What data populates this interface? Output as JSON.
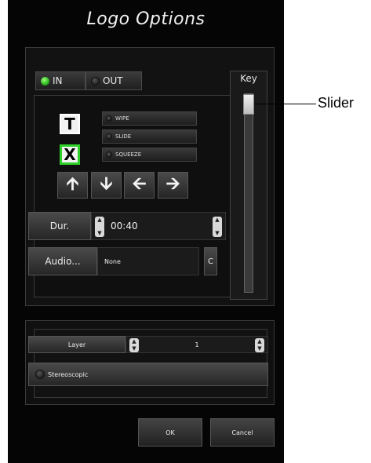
{
  "dialog": {
    "title": "Logo Options"
  },
  "tabs": [
    {
      "label": "IN",
      "active": true
    },
    {
      "label": "OUT",
      "active": false
    }
  ],
  "type_buttons": [
    {
      "label": "T"
    },
    {
      "label": "X"
    }
  ],
  "transitions": [
    {
      "label": "WIPE"
    },
    {
      "label": "SLIDE"
    },
    {
      "label": "SQUEEZE"
    }
  ],
  "arrows": [
    "up-arrow-icon",
    "down-arrow-icon",
    "left-arrow-icon",
    "right-arrow-icon"
  ],
  "duration": {
    "label": "Dur.",
    "value": "00:40"
  },
  "audio": {
    "label": "Audio...",
    "value": "None",
    "clear_label": "C"
  },
  "key": {
    "label": "Key",
    "level": 1.0
  },
  "layer": {
    "label": "Layer",
    "value": "1"
  },
  "stereoscopic": {
    "label": "Stereoscopic"
  },
  "buttons": {
    "ok": "OK",
    "cancel": "Cancel"
  },
  "annotation": {
    "label": "Slider"
  },
  "colors": {
    "led_on": "#2ab51d",
    "background": "#050505"
  }
}
